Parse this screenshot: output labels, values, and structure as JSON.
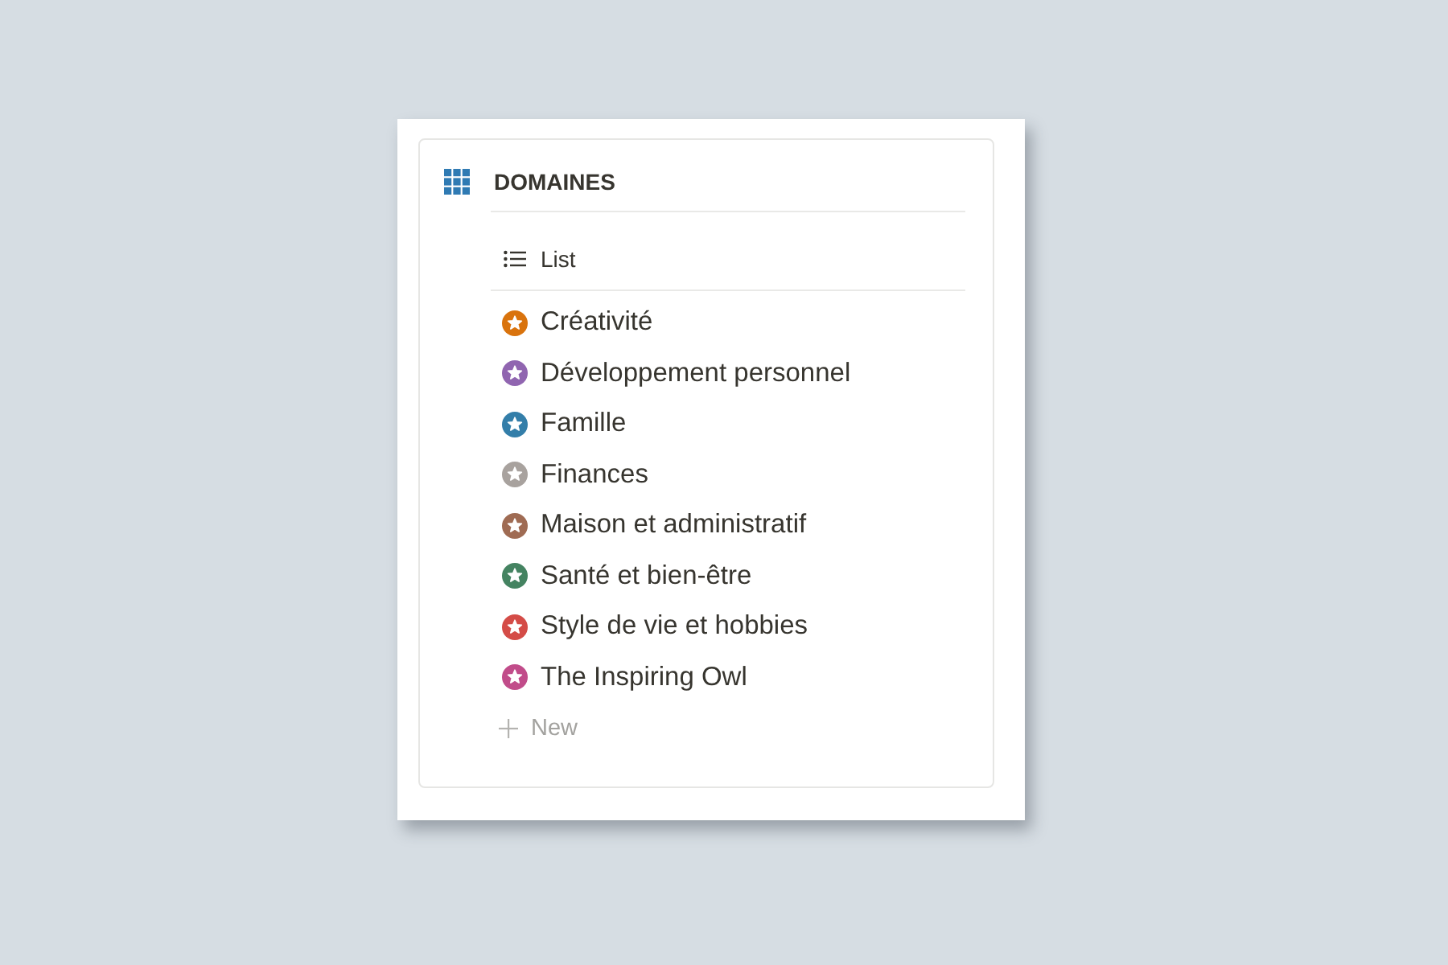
{
  "block": {
    "title": "DOMAINES",
    "view": {
      "label": "List"
    },
    "items": [
      {
        "name": "Créativité",
        "color": "#d9730d"
      },
      {
        "name": "Développement personnel",
        "color": "#9065b0"
      },
      {
        "name": "Famille",
        "color": "#337ea9"
      },
      {
        "name": "Finances",
        "color": "#a8a29e"
      },
      {
        "name": "Maison et administratif",
        "color": "#9f6b53"
      },
      {
        "name": "Santé et bien-être",
        "color": "#448361"
      },
      {
        "name": "Style de vie et hobbies",
        "color": "#d44c47"
      },
      {
        "name": "The Inspiring Owl",
        "color": "#c14c8a"
      }
    ],
    "new_button": {
      "label": "New"
    }
  }
}
